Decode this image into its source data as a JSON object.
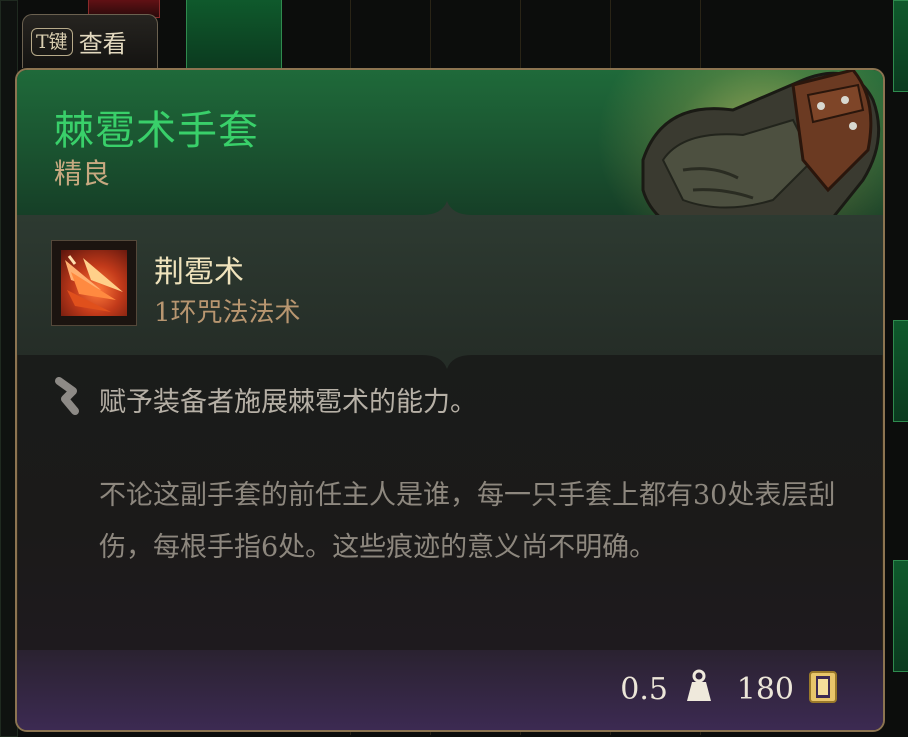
{
  "hotkey": {
    "key": "T键",
    "label": "查看"
  },
  "item": {
    "name": "棘雹术手套",
    "rarity": "精良",
    "name_color": "#39d06a",
    "rarity_color": "#c7a980",
    "icon": "gauntlet-icon"
  },
  "spell": {
    "name": "荆雹术",
    "type": "1环咒法法术",
    "icon": "hail-of-thorns-spell-icon"
  },
  "description": {
    "main": "赋予装备者施展棘雹术的能力。",
    "flavor": "不论这副手套的前任主人是谁，每一只手套上都有30处表层刮伤，每根手指6处。这些痕迹的意义尚不明确。",
    "icon": "passive-feature-icon"
  },
  "footer": {
    "weight": "0.5",
    "weight_icon": "weight-icon",
    "price": "180",
    "price_icon": "gold-coin-icon"
  }
}
